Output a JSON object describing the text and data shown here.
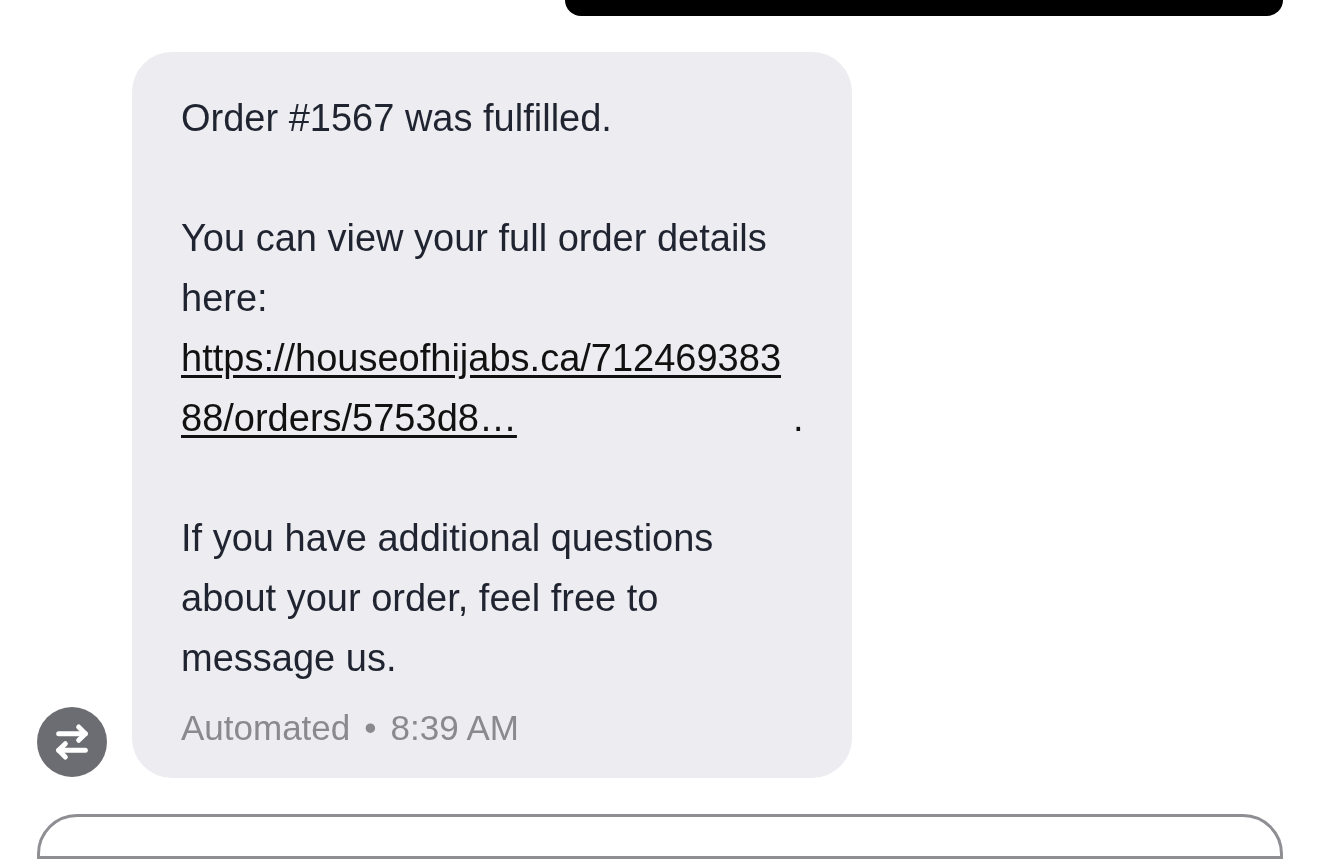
{
  "message": {
    "paragraphs": [
      {
        "kind": "text",
        "text": "Order #1567 was fulfilled."
      },
      {
        "kind": "text",
        "text": "You can view your full order details here:"
      },
      {
        "kind": "link",
        "text": "https://houseofhijabs.ca/71246938388/orders/5753d8…",
        "trailing": "."
      },
      {
        "kind": "text",
        "text": "If you have additional questions about your order, feel free to message us."
      }
    ],
    "label": "Automated",
    "separator": "•",
    "time": "8:39 AM"
  }
}
